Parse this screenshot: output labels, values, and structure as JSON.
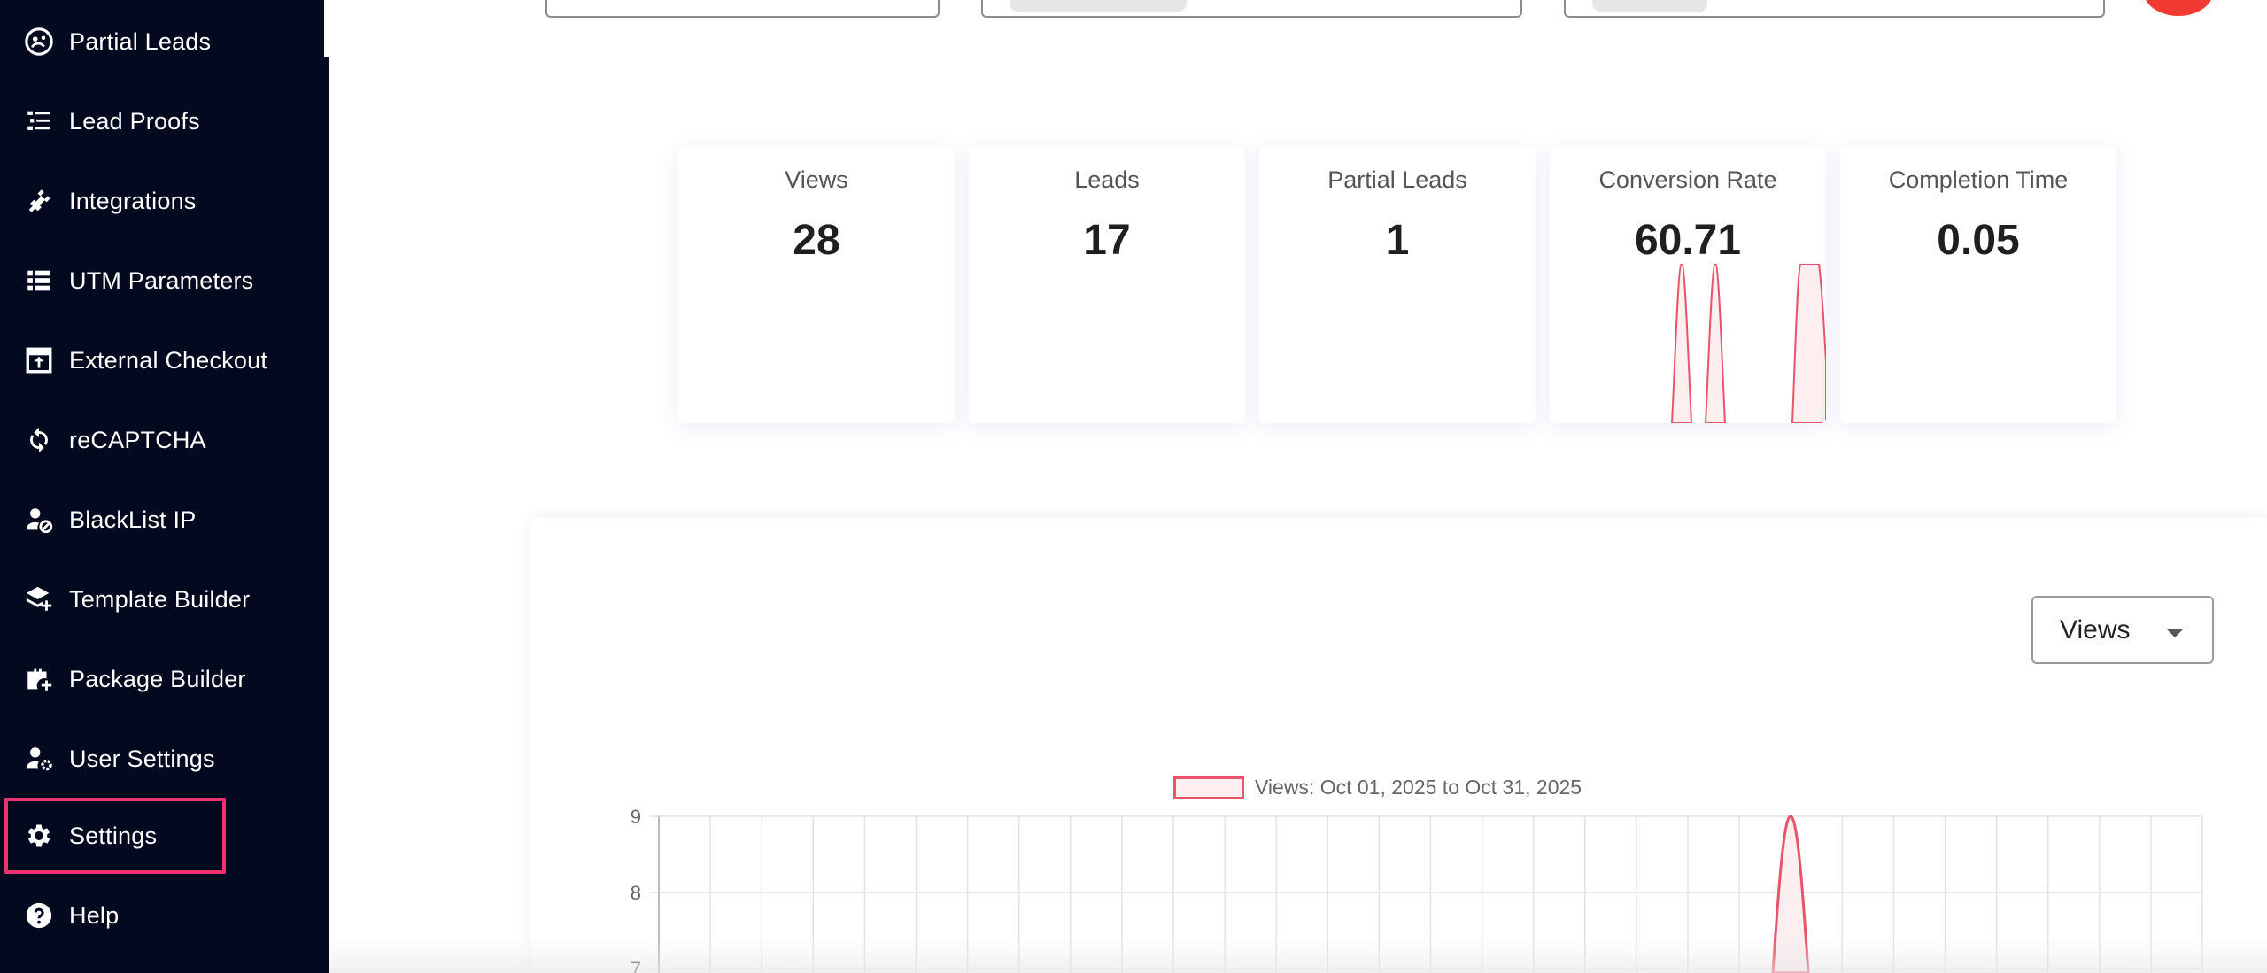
{
  "sidebar": {
    "items": [
      {
        "label": "Partial Leads",
        "icon": "partial-leads-icon"
      },
      {
        "label": "Lead Proofs",
        "icon": "lead-proofs-icon"
      },
      {
        "label": "Integrations",
        "icon": "plug-icon"
      },
      {
        "label": "UTM Parameters",
        "icon": "list-icon"
      },
      {
        "label": "External Checkout",
        "icon": "external-checkout-icon"
      },
      {
        "label": "reCAPTCHA",
        "icon": "refresh-icon"
      },
      {
        "label": "BlackList IP",
        "icon": "user-block-icon"
      },
      {
        "label": "Template Builder",
        "icon": "layers-plus-icon"
      },
      {
        "label": "Package Builder",
        "icon": "briefcase-plus-icon"
      },
      {
        "label": "User Settings",
        "icon": "user-gear-icon"
      },
      {
        "label": "Settings",
        "icon": "gear-icon"
      },
      {
        "label": "Help",
        "icon": "help-icon"
      }
    ],
    "highlighted": "Settings"
  },
  "stats": [
    {
      "title": "Views",
      "value": "28"
    },
    {
      "title": "Leads",
      "value": "17"
    },
    {
      "title": "Partial Leads",
      "value": "1"
    },
    {
      "title": "Conversion Rate",
      "value": "60.71"
    },
    {
      "title": "Completion Time",
      "value": "0.05"
    }
  ],
  "metric_select": {
    "selected": "Views"
  },
  "colors": {
    "sidebar_bg": "#030a1f",
    "accent_red": "#e8556b",
    "highlight": "#f0306f"
  },
  "chart_data": {
    "type": "line",
    "series": [
      {
        "name": "Views: Oct 01, 2025 to Oct 31, 2025"
      }
    ],
    "y_ticks": [
      "9",
      "8",
      "7"
    ],
    "ylim": [
      7,
      9
    ],
    "grid": true,
    "legend_position": "top-center"
  }
}
